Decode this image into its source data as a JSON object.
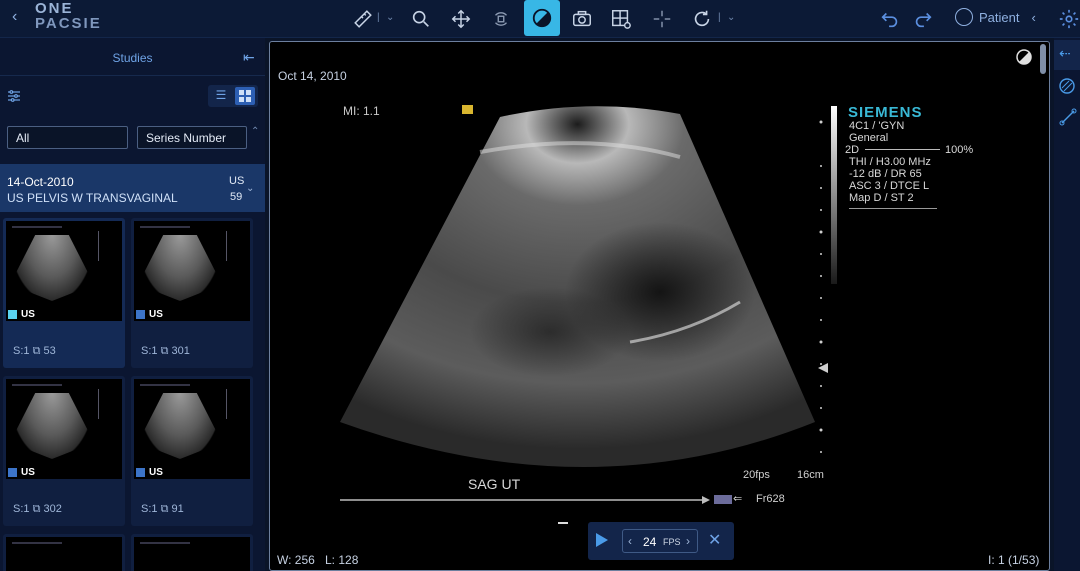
{
  "app": {
    "logo_line1": "ONE",
    "logo_line2": "PACSIE",
    "patient_label": "Patient"
  },
  "toolbar": {
    "icons": [
      "ruler-icon",
      "zoom-icon",
      "pan-icon",
      "rotate-icon",
      "contrast-icon",
      "camera-icon",
      "layout-icon",
      "crosshair-icon",
      "reset-icon",
      "undo-icon",
      "redo-icon"
    ],
    "active": "contrast-icon"
  },
  "sidebar": {
    "title": "Studies",
    "filter_value": "All",
    "sort_value": "Series Number",
    "study": {
      "date": "14-Oct-2010",
      "description": "US PELVIS W TRANSVAGINAL",
      "modality": "US",
      "count": "59"
    },
    "series": [
      {
        "modality": "US",
        "series": "S:1",
        "images": "53",
        "selected": true
      },
      {
        "modality": "US",
        "series": "S:1",
        "images": "301",
        "selected": false
      },
      {
        "modality": "US",
        "series": "S:1",
        "images": "302",
        "selected": false
      },
      {
        "modality": "US",
        "series": "S:1",
        "images": "91",
        "selected": false
      }
    ]
  },
  "viewer": {
    "date": "Oct 14, 2010",
    "mi": "MI:  1.1",
    "vendor": "SIEMENS",
    "probe": "4C1 / 'GYN",
    "preset": "General",
    "mode": "2D",
    "power": "100%",
    "freq": "THI / H3.00 MHz",
    "gain": "-12 dB / DR 65",
    "asc": "ASC 3 / DTCE L",
    "map": "Map D / ST 2",
    "fps_label": "20fps",
    "depth": "16cm",
    "annotation": "SAG  UT",
    "frame": "Fr628",
    "ww": "W: 256",
    "wl": "L: 128",
    "image_index": "I: 1 (1/53)"
  },
  "playback": {
    "fps": "24",
    "fps_unit": "FPS"
  },
  "colors": {
    "accent": "#38b7e6",
    "brand": "#39b9d6"
  }
}
